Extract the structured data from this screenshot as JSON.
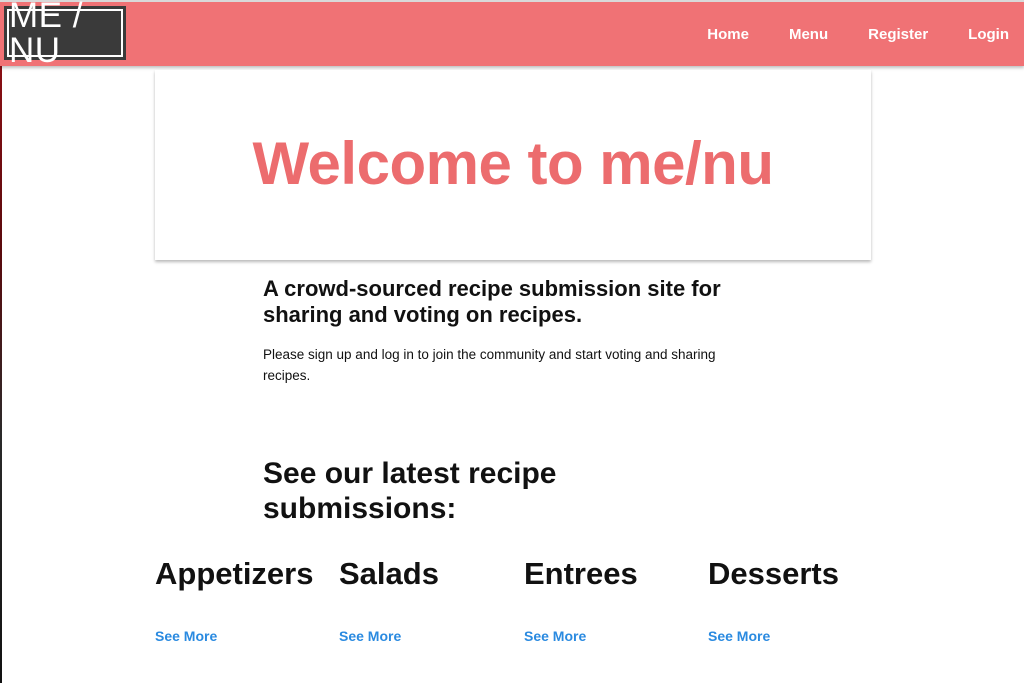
{
  "nav": {
    "logo_text": "ME / NU",
    "links": [
      {
        "label": "Home"
      },
      {
        "label": "Menu"
      },
      {
        "label": "Register"
      },
      {
        "label": "Login"
      }
    ]
  },
  "hero": {
    "title": "Welcome to me/nu"
  },
  "intro": {
    "heading": "A crowd-sourced recipe submission site for sharing and voting on recipes.",
    "text": "Please sign up and log in to join the community and start voting and sharing recipes."
  },
  "latest": {
    "heading": "See our latest recipe submissions:"
  },
  "categories": [
    {
      "title": "Appetizers",
      "link": "See More"
    },
    {
      "title": "Salads",
      "link": "See More"
    },
    {
      "title": "Entrees",
      "link": "See More"
    },
    {
      "title": "Desserts",
      "link": "See More"
    }
  ],
  "colors": {
    "navbar": "#f07275",
    "hero_title": "#ec6c6e",
    "logo_bg": "#3a3a3a",
    "link": "#2a8ae0"
  }
}
